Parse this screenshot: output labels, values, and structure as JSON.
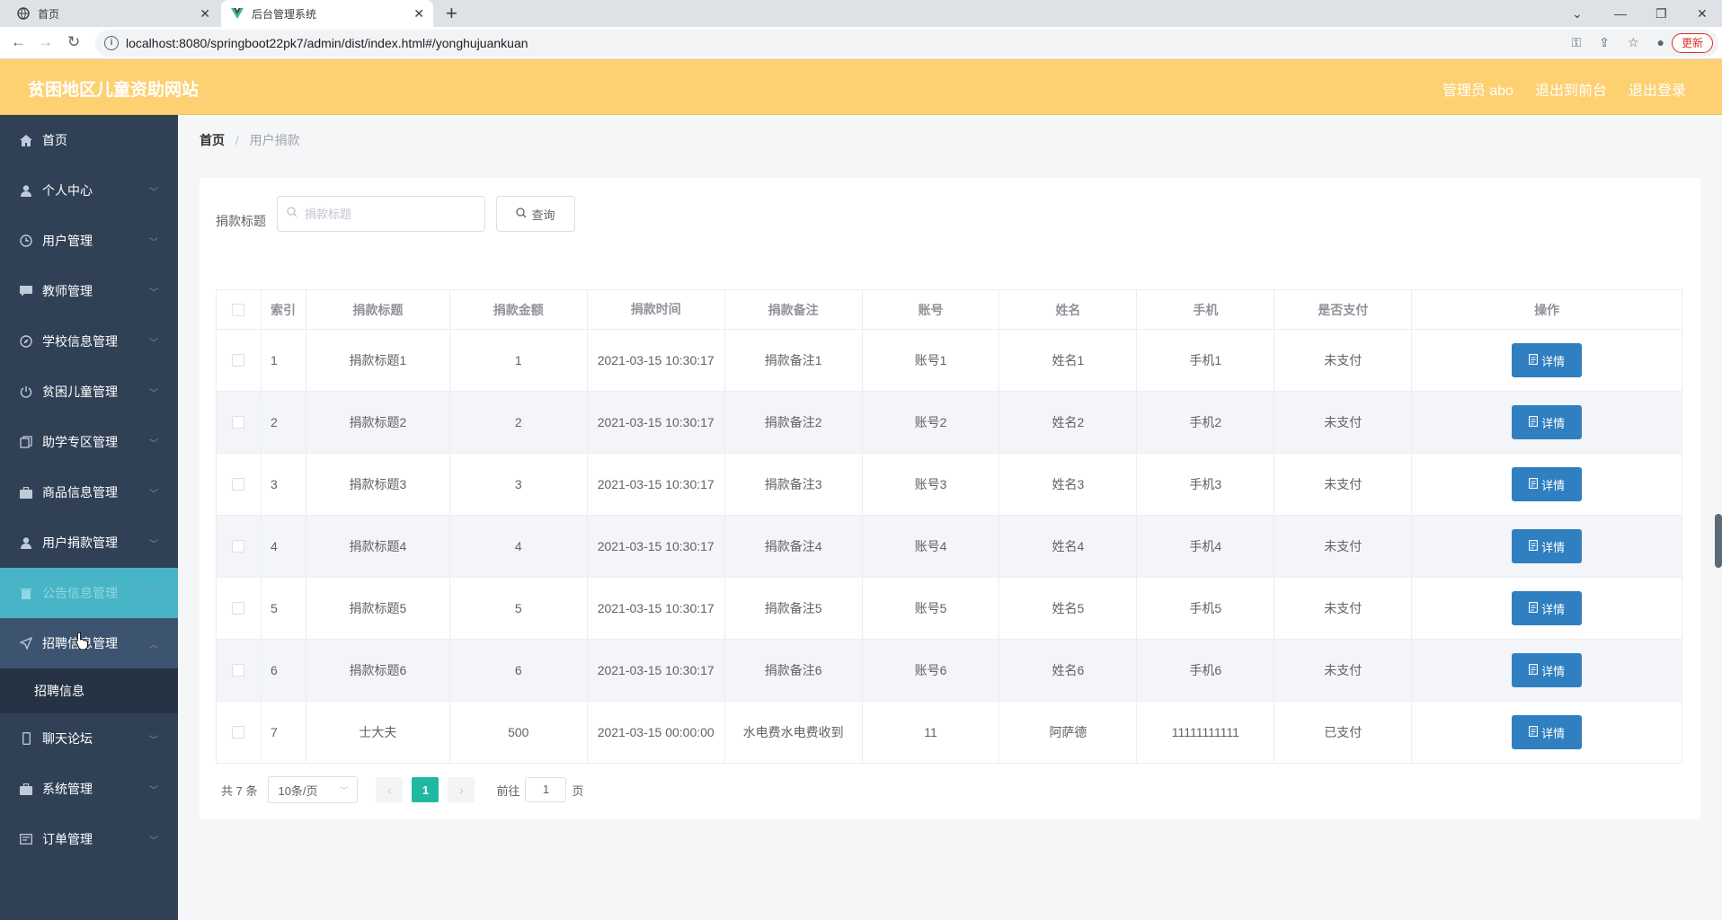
{
  "browser": {
    "tabs": [
      {
        "title": "首页"
      },
      {
        "title": "后台管理系统"
      }
    ],
    "url": "localhost:8080/springboot22pk7/admin/dist/index.html#/yonghujuankuan",
    "update_label": "更新"
  },
  "header": {
    "title": "贫困地区儿童资助网站",
    "user_label": "管理员 abo",
    "front_label": "退出到前台",
    "logout_label": "退出登录"
  },
  "sidebar": {
    "items": [
      {
        "label": "首页",
        "icon": "home-icon"
      },
      {
        "label": "个人中心",
        "icon": "user-icon"
      },
      {
        "label": "用户管理",
        "icon": "clock-icon"
      },
      {
        "label": "教师管理",
        "icon": "message-icon"
      },
      {
        "label": "学校信息管理",
        "icon": "compass-icon"
      },
      {
        "label": "贫困儿童管理",
        "icon": "power-icon"
      },
      {
        "label": "助学专区管理",
        "icon": "copy-icon"
      },
      {
        "label": "商品信息管理",
        "icon": "suitcase-icon"
      },
      {
        "label": "用户捐款管理",
        "icon": "user-icon"
      },
      {
        "label": "公告信息管理",
        "icon": "delete-icon"
      },
      {
        "label": "招聘信息管理",
        "icon": "send-icon"
      },
      {
        "label": "聊天论坛",
        "icon": "mobile-icon"
      },
      {
        "label": "系统管理",
        "icon": "suitcase-icon"
      },
      {
        "label": "订单管理",
        "icon": "tickets-icon"
      }
    ],
    "submenu_label": "招聘信息"
  },
  "breadcrumb": {
    "home": "首页",
    "separator": "/",
    "current": "用户捐款"
  },
  "search": {
    "label": "捐款标题",
    "placeholder": "捐款标题",
    "query_label": "查询"
  },
  "table": {
    "headers": [
      "索引",
      "捐款标题",
      "捐款金额",
      "捐款时间",
      "捐款备注",
      "账号",
      "姓名",
      "手机",
      "是否支付",
      "操作"
    ],
    "detail_label": "详情",
    "rows": [
      {
        "idx": "1",
        "title": "捐款标题1",
        "amount": "1",
        "time": "2021-03-15 10:30:17",
        "note": "捐款备注1",
        "account": "账号1",
        "name": "姓名1",
        "phone": "手机1",
        "paid": "未支付"
      },
      {
        "idx": "2",
        "title": "捐款标题2",
        "amount": "2",
        "time": "2021-03-15 10:30:17",
        "note": "捐款备注2",
        "account": "账号2",
        "name": "姓名2",
        "phone": "手机2",
        "paid": "未支付"
      },
      {
        "idx": "3",
        "title": "捐款标题3",
        "amount": "3",
        "time": "2021-03-15 10:30:17",
        "note": "捐款备注3",
        "account": "账号3",
        "name": "姓名3",
        "phone": "手机3",
        "paid": "未支付"
      },
      {
        "idx": "4",
        "title": "捐款标题4",
        "amount": "4",
        "time": "2021-03-15 10:30:17",
        "note": "捐款备注4",
        "account": "账号4",
        "name": "姓名4",
        "phone": "手机4",
        "paid": "未支付"
      },
      {
        "idx": "5",
        "title": "捐款标题5",
        "amount": "5",
        "time": "2021-03-15 10:30:17",
        "note": "捐款备注5",
        "account": "账号5",
        "name": "姓名5",
        "phone": "手机5",
        "paid": "未支付"
      },
      {
        "idx": "6",
        "title": "捐款标题6",
        "amount": "6",
        "time": "2021-03-15 10:30:17",
        "note": "捐款备注6",
        "account": "账号6",
        "name": "姓名6",
        "phone": "手机6",
        "paid": "未支付"
      },
      {
        "idx": "7",
        "title": "士大夫",
        "amount": "500",
        "time": "2021-03-15 00:00:00",
        "note": "水电费水电费收到",
        "account": "11",
        "name": "阿萨德",
        "phone": "11111111111",
        "paid": "已支付"
      }
    ]
  },
  "pagination": {
    "total": "共 7 条",
    "page_size": "10条/页",
    "current_page": "1",
    "goto_label": "前往",
    "goto_value": "1",
    "page_suffix": "页"
  },
  "colors": {
    "header_bg": "#fdd071",
    "sidebar_bg": "#304156",
    "active_menu": "#48b5c6",
    "detail_button": "#2f7fc1",
    "pager_active": "#1fb8a2"
  }
}
